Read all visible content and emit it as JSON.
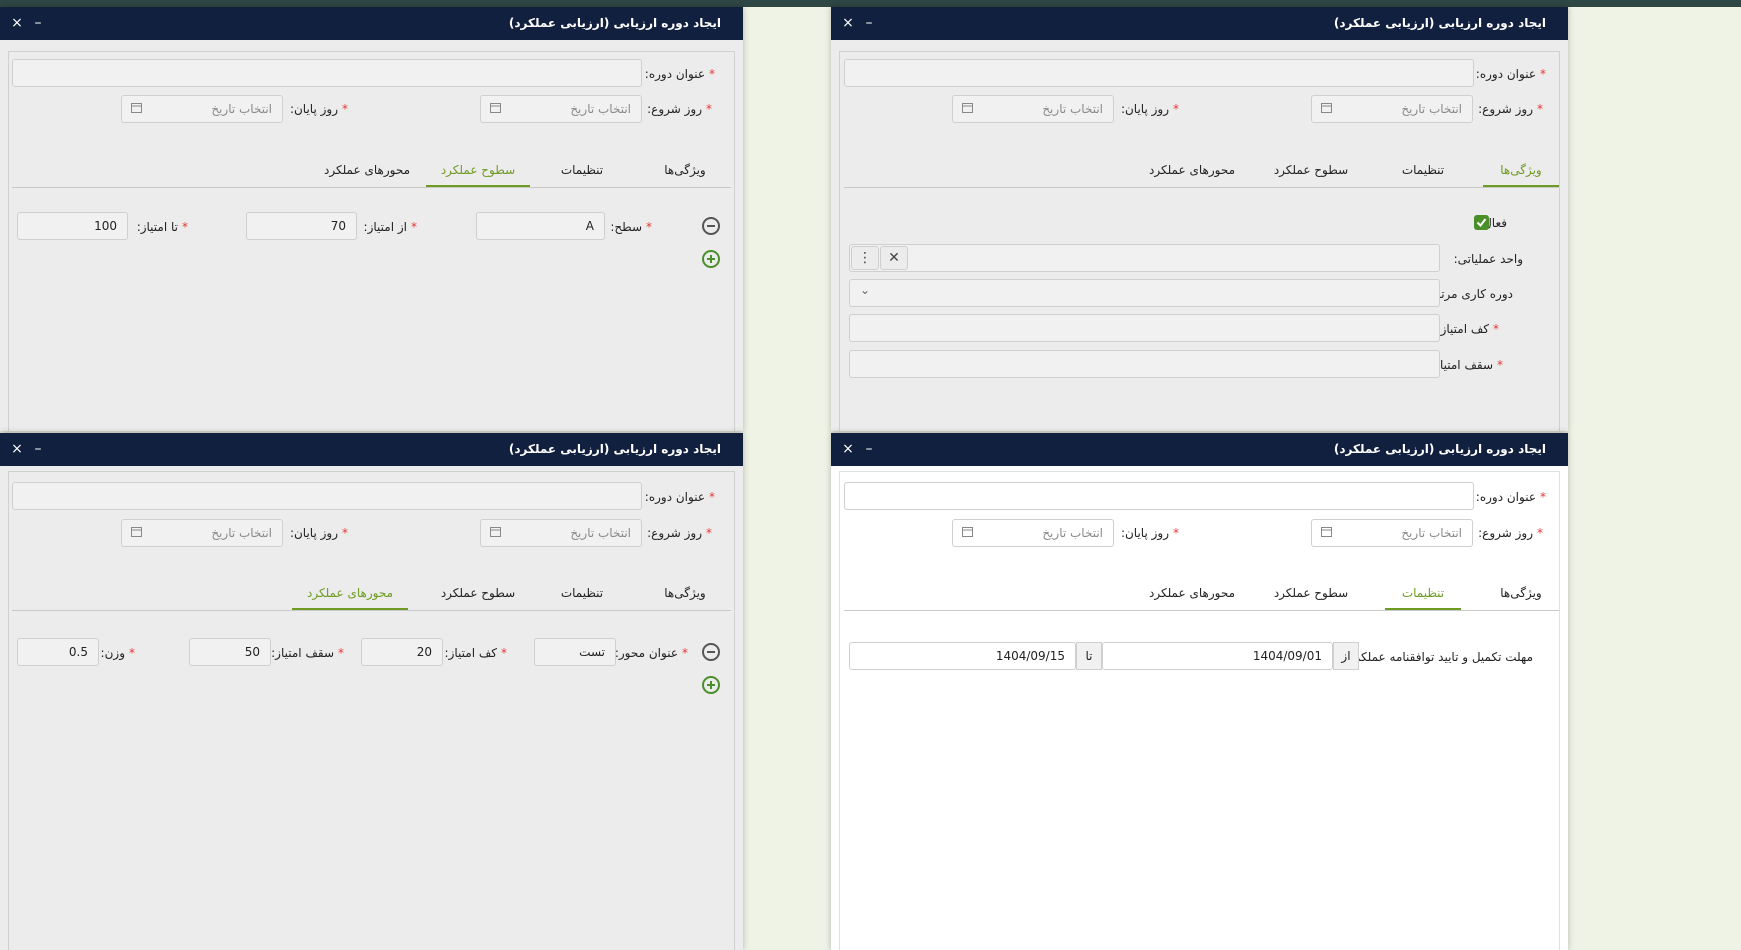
{
  "dialog_title": "ایجاد دوره ارزیابی (ارزیابی عملکرد)",
  "window_controls": {
    "close": "×",
    "minimize": "–"
  },
  "form": {
    "course_title_label": "عنوان دوره:",
    "start_day_label": "روز شروع:",
    "end_day_label": "روز پایان:",
    "date_placeholder": "انتخاب تاریخ",
    "required_mark": "*"
  },
  "tabs": {
    "features": "ویژگی‌ها",
    "settings": "تنظیمات",
    "levels": "سطوح عملکرد",
    "axes": "محورهای عملکرد"
  },
  "features_tab": {
    "active_label": "فعال:",
    "active_checked": true,
    "operational_unit_label": "واحد عملیاتی:",
    "related_work_period_label": "دوره کاری مرتبط",
    "min_score_label": "کف امتیاز:",
    "max_score_label": "سقف امتیاز:",
    "menu_icon": "⋮",
    "clear_icon": "✕",
    "dropdown_icon": "⌄"
  },
  "levels_tab": {
    "level_label": "سطح:",
    "level_value": "A",
    "from_score_label": "از امتیاز:",
    "from_score_value": "70",
    "to_score_label": "تا امتیاز:",
    "to_score_value": "100"
  },
  "settings_tab": {
    "deadline_label": "مهلت تکمیل و تایید توافقنامه عملکرد:",
    "from_label": "از",
    "from_value": "1404/09/01",
    "to_label": "تا",
    "to_value": "1404/09/15"
  },
  "axes_tab": {
    "axis_title_label": "عنوان محور:",
    "axis_title_value": "تست",
    "min_score_label": "کف امتیاز:",
    "min_score_value": "20",
    "max_score_label": "سقف امتیاز:",
    "max_score_value": "50",
    "weight_label": "وزن:",
    "weight_value": "0.5"
  },
  "colors": {
    "titlebar": "#12203f",
    "active_tab": "#6e9b23",
    "required": "#e53935",
    "checkbox": "#4a8f2a"
  }
}
